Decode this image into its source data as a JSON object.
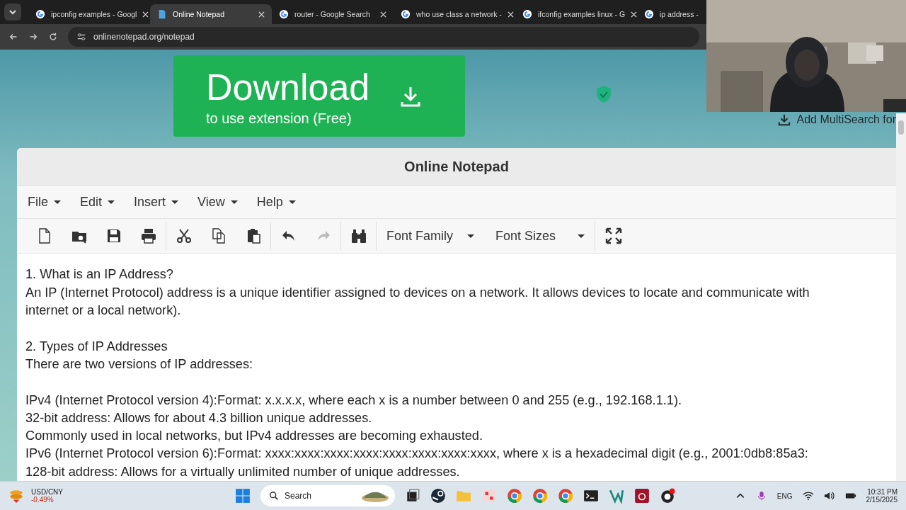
{
  "browser": {
    "tabs": [
      {
        "title": "ipconfig examples - Googl",
        "selected": false,
        "kind": "google"
      },
      {
        "title": "Online Notepad",
        "selected": true,
        "kind": "doc"
      },
      {
        "title": "router - Google Search",
        "selected": false,
        "kind": "google"
      },
      {
        "title": "who use class a network - ",
        "selected": false,
        "kind": "google"
      },
      {
        "title": "ifconfig examples linux - G",
        "selected": false,
        "kind": "google"
      },
      {
        "title": "ip address -",
        "selected": false,
        "kind": "google"
      }
    ],
    "url": "onlinenotepad.org/notepad"
  },
  "ad": {
    "title": "Download",
    "subtitle": "to use extension (Free)"
  },
  "extension_link": "Add MultiSearch for",
  "notepad": {
    "title": "Online Notepad",
    "menu": [
      "File",
      "Edit",
      "Insert",
      "View",
      "Help"
    ],
    "toolbar": {
      "buttons": [
        {
          "disabled": false
        },
        {
          "disabled": false
        },
        {
          "disabled": false
        },
        {
          "disabled": false
        },
        {
          "disabled": false
        },
        {
          "disabled": false
        },
        {
          "disabled": false
        },
        {
          "disabled": false
        },
        {
          "disabled": true
        },
        {
          "disabled": false
        }
      ],
      "dropdowns": [
        "Font Family",
        "Font Sizes"
      ]
    },
    "paragraphs": [
      [
        "1. What is an IP Address?",
        "An IP (Internet Protocol) address is a unique identifier assigned to devices on a network. It allows devices to locate and communicate with",
        "internet or a local network)."
      ],
      [
        "2. Types of IP Addresses",
        "There are two versions of IP addresses:"
      ],
      [
        "IPv4 (Internet Protocol version 4):Format: x.x.x.x, where each x is a number between 0 and 255 (e.g., 192.168.1.1).",
        "32-bit address: Allows for about 4.3 billion unique addresses.",
        "Commonly used in local networks, but IPv4 addresses are becoming exhausted.",
        "IPv6 (Internet Protocol version 6):Format: xxxx:xxxx:xxxx:xxxx:xxxx:xxxx:xxxx:xxxx, where x is a hexadecimal digit (e.g., 2001:0db8:85a3:",
        "128-bit address: Allows for a virtually unlimited number of unique addresses."
      ]
    ]
  },
  "taskbar": {
    "widget": {
      "label": "USD/CNY",
      "change": "-0.49%"
    },
    "search": "Search",
    "language": "ENG",
    "time": "10:31 PM",
    "date": "2/15/2025"
  }
}
